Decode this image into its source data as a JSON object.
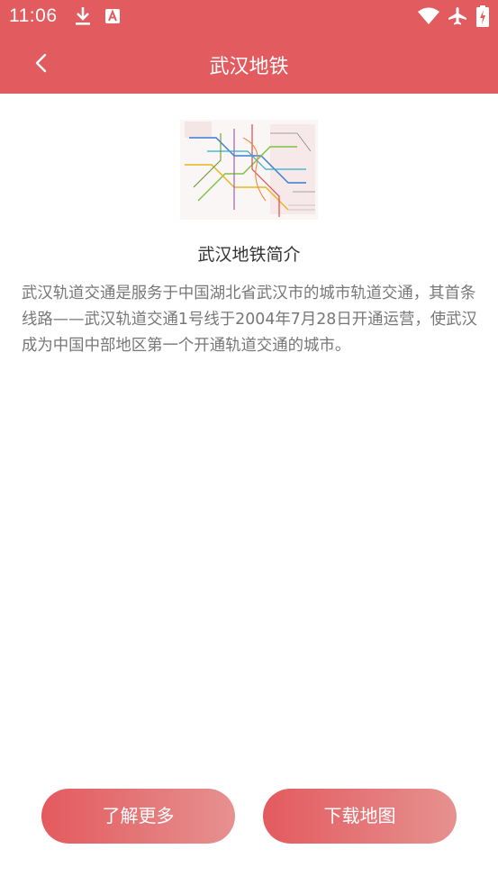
{
  "status_bar": {
    "time": "11:06",
    "icons": [
      "download-icon",
      "a-notification-icon",
      "wifi-icon",
      "airplane-icon",
      "battery-icon"
    ],
    "color": "#e25b5f"
  },
  "header": {
    "title": "武汉地铁",
    "back_icon": "chevron-left-icon"
  },
  "intro": {
    "title": "武汉地铁简介",
    "body": "武汉轨道交通是服务于中国湖北省武汉市的城市轨道交通，其首条线路——武汉轨道交通1号线于2004年7月28日开通运营，使武汉成为中国中部地区第一个开通轨道交通的城市。"
  },
  "buttons": {
    "learn_more": "了解更多",
    "download_map": "下载地图"
  },
  "colors": {
    "accent": "#e25b5f",
    "button_gradient_end": "#e69190"
  }
}
